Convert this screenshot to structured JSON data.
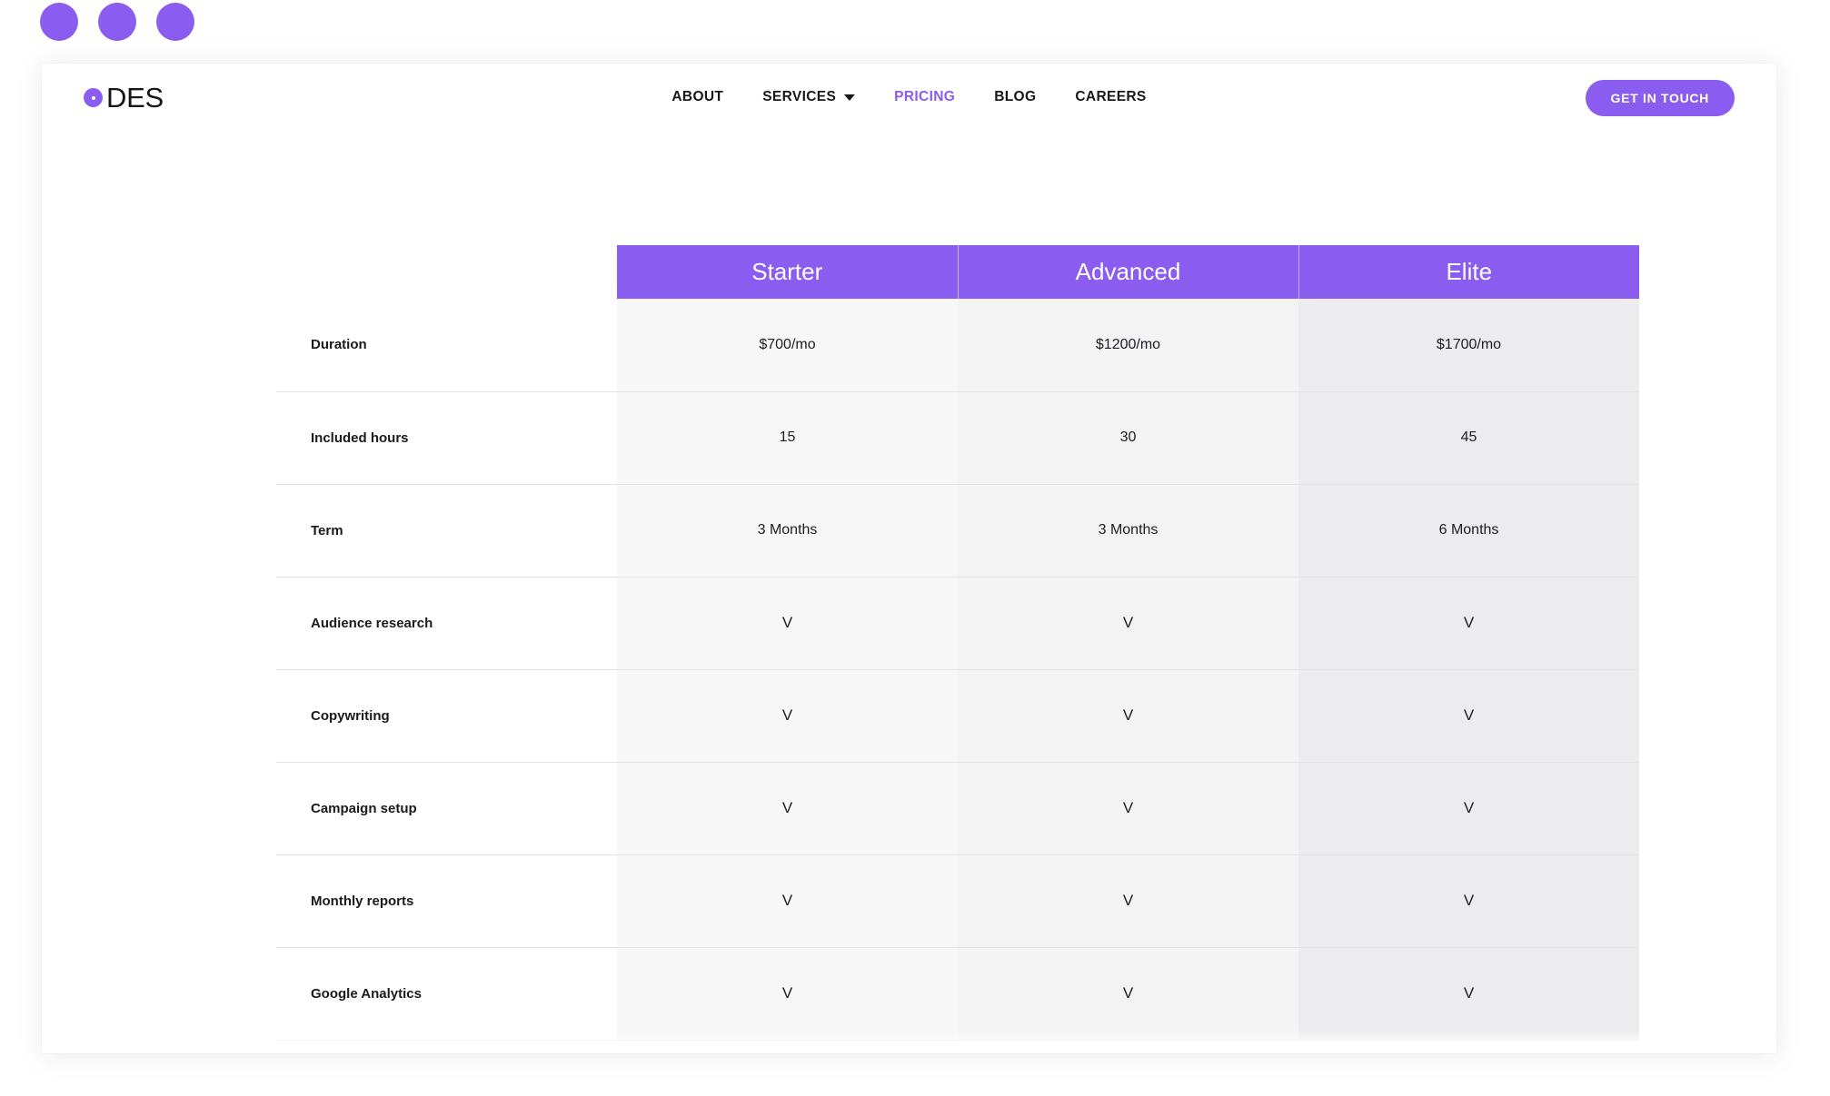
{
  "theme": {
    "accent": "#8B5CF0",
    "text": "#17171c",
    "col1_bg": "#f7f7f8",
    "col2_bg": "#f3f3f4",
    "col3_bg": "#ececee",
    "divider": "#e3e3e5"
  },
  "window_dots": [
    "dot-1",
    "dot-2",
    "dot-3"
  ],
  "header": {
    "brand": {
      "mark": "circle-dot-logo-icon",
      "name": "DES"
    },
    "nav": [
      {
        "label": "ABOUT",
        "active": false,
        "has_caret": false
      },
      {
        "label": "SERVICES",
        "active": false,
        "has_caret": true
      },
      {
        "label": "PRICING",
        "active": true,
        "has_caret": false
      },
      {
        "label": "BLOG",
        "active": false,
        "has_caret": false
      },
      {
        "label": "CAREERS",
        "active": false,
        "has_caret": false
      }
    ],
    "cta_label": "GET IN TOUCH"
  },
  "pricing_table": {
    "feature_column_header": "",
    "plans": [
      "Starter",
      "Advanced",
      "Elite"
    ],
    "rows": [
      {
        "feature": "Duration",
        "values": [
          "$700/mo",
          "$1200/mo",
          "$1700/mo"
        ],
        "type": "text"
      },
      {
        "feature": "Included hours",
        "values": [
          "15",
          "30",
          "45"
        ],
        "type": "text"
      },
      {
        "feature": "Term",
        "values": [
          "3 Months",
          "3 Months",
          "6 Months"
        ],
        "type": "text"
      },
      {
        "feature": "Audience research",
        "values": [
          "V",
          "V",
          "V"
        ],
        "type": "check"
      },
      {
        "feature": "Copywriting",
        "values": [
          "V",
          "V",
          "V"
        ],
        "type": "check"
      },
      {
        "feature": "Campaign setup",
        "values": [
          "V",
          "V",
          "V"
        ],
        "type": "check"
      },
      {
        "feature": "Monthly reports",
        "values": [
          "V",
          "V",
          "V"
        ],
        "type": "check"
      },
      {
        "feature": "Google Analytics",
        "values": [
          "V",
          "V",
          "V"
        ],
        "type": "check"
      }
    ]
  }
}
